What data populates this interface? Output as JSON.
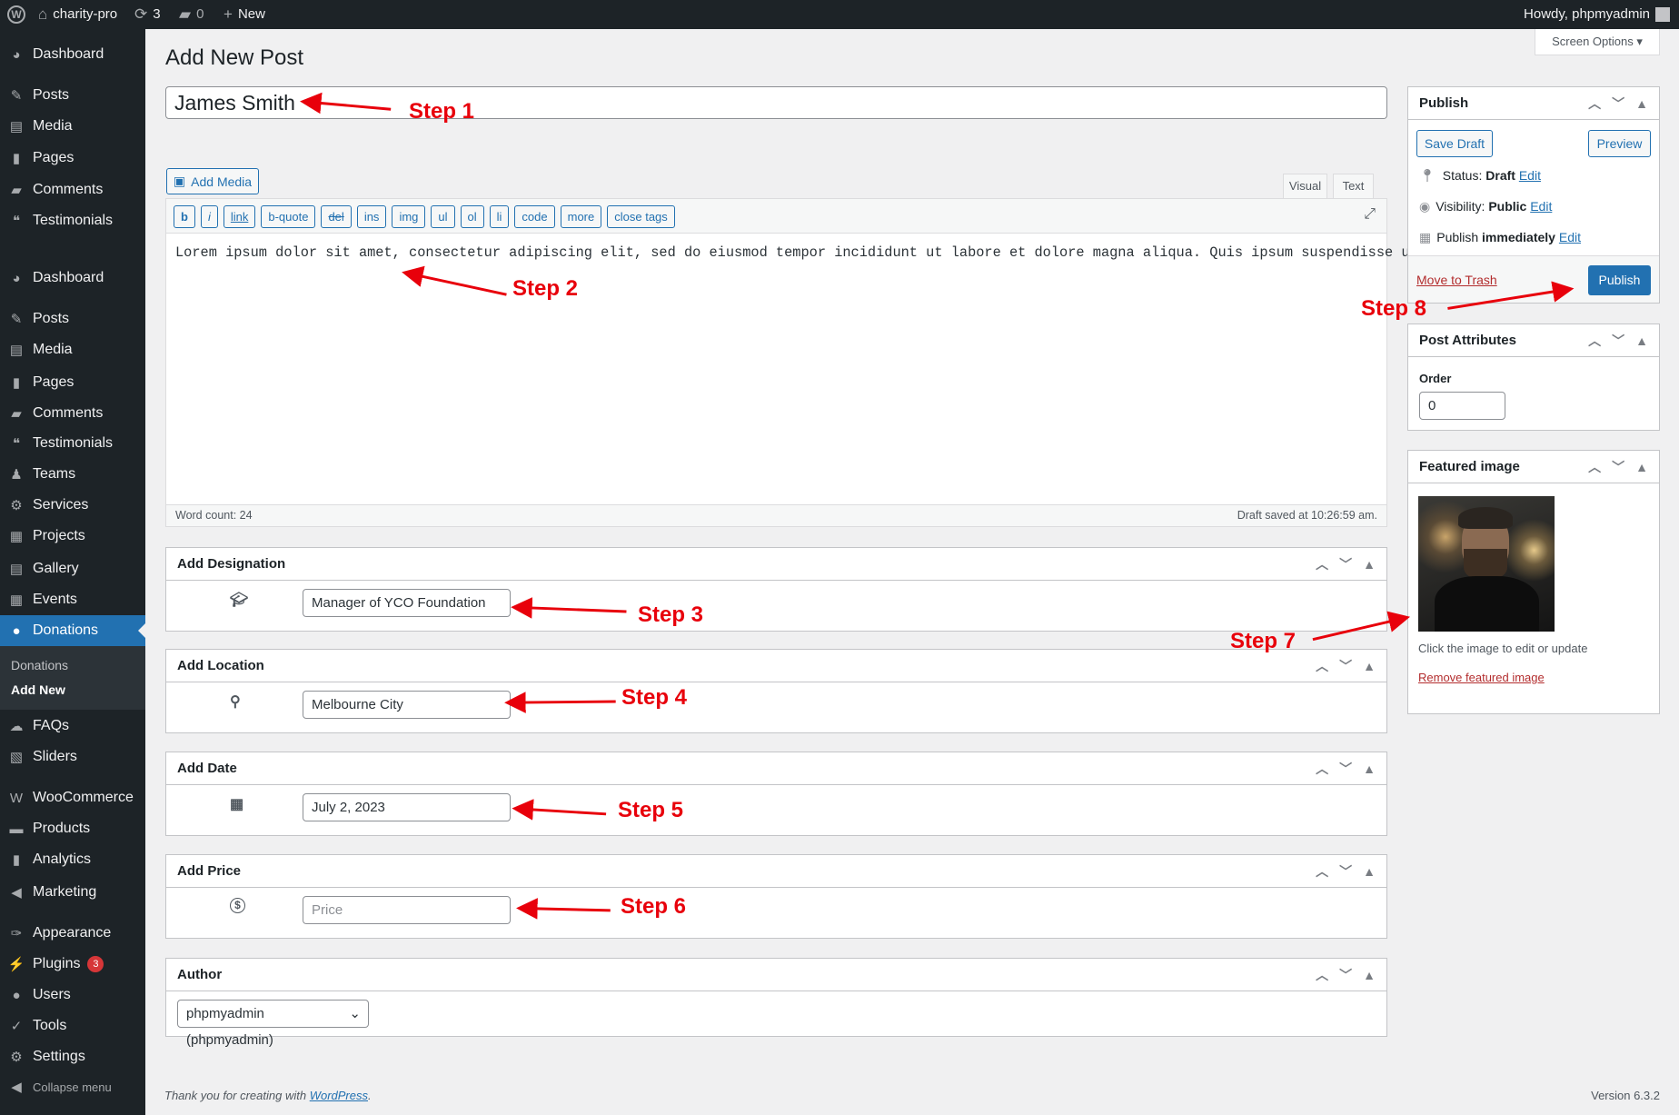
{
  "adminbar": {
    "site": "charity-pro",
    "updates": "3",
    "comments": "0",
    "new": "New",
    "howdy": "Howdy, phpmyadmin"
  },
  "sidebar": {
    "items": [
      "Dashboard",
      "Posts",
      "Media",
      "Pages",
      "Comments",
      "Testimonials",
      "Dashboard",
      "Posts",
      "Media",
      "Pages",
      "Comments",
      "Testimonials",
      "Teams",
      "Services",
      "Projects",
      "Gallery",
      "Events",
      "Donations",
      "FAQs",
      "Sliders",
      "WooCommerce",
      "Products",
      "Analytics",
      "Marketing",
      "Appearance",
      "Plugins",
      "Users",
      "Tools",
      "Settings",
      "Collapse menu"
    ],
    "submenu": [
      "Donations",
      "Add New"
    ],
    "plugins_badge": "3"
  },
  "page": {
    "title": "Add New Post",
    "screen_options": "Screen Options ▾",
    "post_title": "James Smith"
  },
  "editor": {
    "add_media": "Add Media",
    "tab_visual": "Visual",
    "tab_text": "Text",
    "toolbar": [
      "b",
      "i",
      "link",
      "b-quote",
      "del",
      "ins",
      "img",
      "ul",
      "ol",
      "li",
      "code",
      "more",
      "close tags"
    ],
    "content": "Lorem ipsum dolor sit amet, consectetur adipiscing elit, sed do eiusmod tempor incididunt ut labore et dolore magna aliqua. Quis ipsum suspendisse ultrices gra...",
    "word_count": "Word count: 24",
    "draft_saved": "Draft saved at 10:26:59 am."
  },
  "metaboxes": {
    "designation": {
      "title": "Add Designation",
      "value": "Manager of YCO Foundation"
    },
    "location": {
      "title": "Add Location",
      "value": "Melbourne City"
    },
    "date": {
      "title": "Add Date",
      "value": "July 2, 2023"
    },
    "price": {
      "title": "Add Price",
      "value": "",
      "placeholder": "Price"
    },
    "author": {
      "title": "Author",
      "value": "phpmyadmin (phpmyadmin)"
    }
  },
  "publish": {
    "title": "Publish",
    "save_draft": "Save Draft",
    "preview": "Preview",
    "status_label": "Status:",
    "status": "Draft",
    "visibility_label": "Visibility:",
    "visibility": "Public",
    "publish_label": "Publish",
    "publish_when": "immediately",
    "edit": "Edit",
    "trash": "Move to Trash",
    "publish_btn": "Publish"
  },
  "attributes": {
    "title": "Post Attributes",
    "order_label": "Order",
    "order": "0"
  },
  "featured": {
    "title": "Featured image",
    "caption": "Click the image to edit or update",
    "remove": "Remove featured image"
  },
  "footer": {
    "thanks": "Thank you for creating with ",
    "wp": "WordPress",
    "period": ".",
    "version": "Version 6.3.2"
  },
  "annotations": [
    "Step 1",
    "Step 2",
    "Step 3",
    "Step 4",
    "Step 5",
    "Step 6",
    "Step 7",
    "Step 8"
  ],
  "colors": {
    "accent": "#2271b1",
    "adminbar": "#1d2327",
    "annotation": "#e8000b"
  }
}
